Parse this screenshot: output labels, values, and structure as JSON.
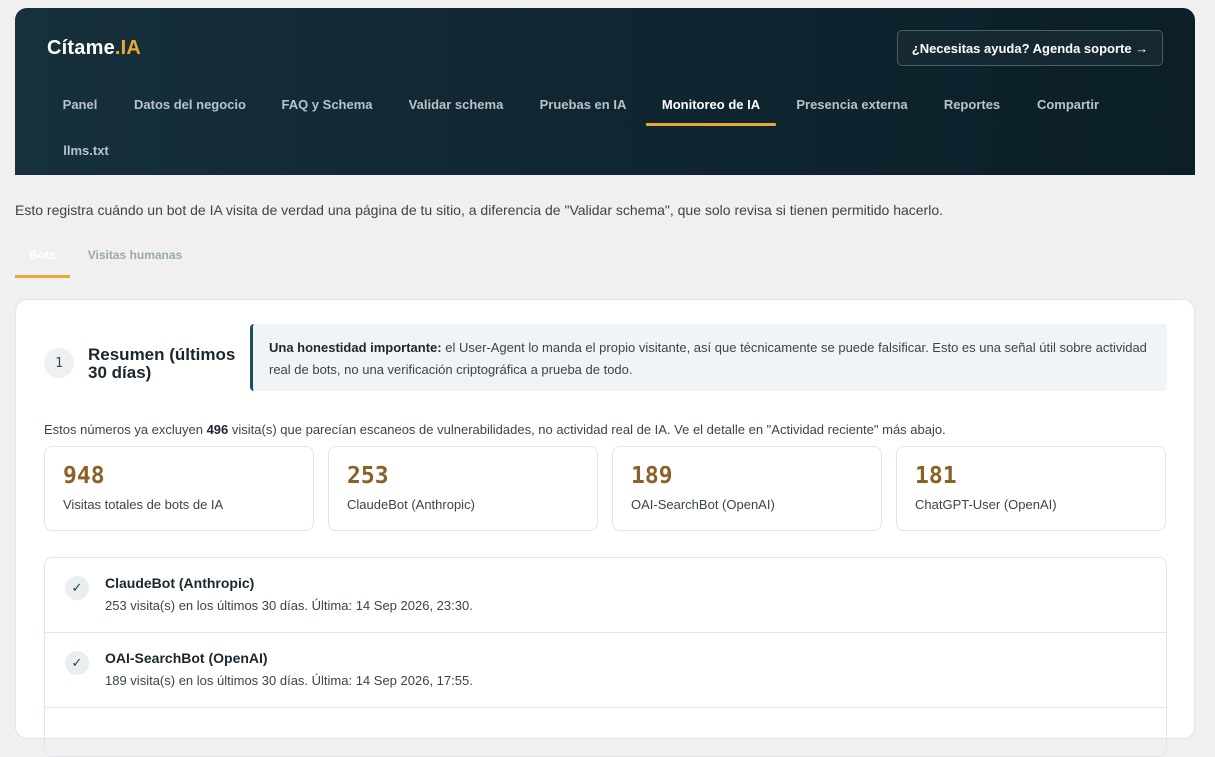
{
  "header": {
    "logo_main": "Cítame",
    "logo_accent": ".IA",
    "help_button": "¿Necesitas ayuda? Agenda soporte →"
  },
  "nav": [
    {
      "label": "Panel",
      "active": false
    },
    {
      "label": "Datos del negocio",
      "active": false
    },
    {
      "label": "FAQ y Schema",
      "active": false
    },
    {
      "label": "Validar schema",
      "active": false
    },
    {
      "label": "Pruebas en IA",
      "active": false
    },
    {
      "label": "Monitoreo de IA",
      "active": true
    },
    {
      "label": "Presencia externa",
      "active": false
    },
    {
      "label": "Reportes",
      "active": false
    },
    {
      "label": "Compartir",
      "active": false
    },
    {
      "label": "llms.txt",
      "active": false
    }
  ],
  "intro": "Esto registra cuándo un bot de IA visita de verdad una página de tu sitio, a diferencia de \"Validar schema\", que solo revisa si tienen permitido hacerlo.",
  "subtabs": [
    {
      "label": "Bots",
      "active": true
    },
    {
      "label": "Visitas humanas",
      "active": false
    }
  ],
  "summary": {
    "step": "1",
    "title": "Resumen (últimos 30 días)",
    "notice_strong": "Una honestidad importante:",
    "notice_text": " el User-Agent lo manda el propio visitante, así que técnicamente se puede falsificar. Esto es una señal útil sobre actividad real de bots, no una verificación criptográfica a prueba de todo.",
    "exclusion_before": "Estos números ya excluyen ",
    "exclusion_count": "496",
    "exclusion_after": " visita(s) que parecían escaneos de vulnerabilidades, no actividad real de IA. Ve el detalle en \"Actividad reciente\" más abajo."
  },
  "stats": [
    {
      "value": "948",
      "label": "Visitas totales de bots de IA"
    },
    {
      "value": "253",
      "label": "ClaudeBot (Anthropic)"
    },
    {
      "value": "189",
      "label": "OAI-SearchBot (OpenAI)"
    },
    {
      "value": "181",
      "label": "ChatGPT-User (OpenAI)"
    }
  ],
  "bots": [
    {
      "name": "ClaudeBot (Anthropic)",
      "meta": "253 visita(s) en los últimos 30 días. Última: 14 Sep 2026, 23:30.",
      "icon": "check-icon"
    },
    {
      "name": "OAI-SearchBot (OpenAI)",
      "meta": "189 visita(s) en los últimos 30 días. Última: 14 Sep 2026, 17:55.",
      "icon": "check-icon"
    }
  ],
  "colors": {
    "accent": "#e8a83a",
    "header_bg": "#0f2530",
    "stat_value": "#8a6226"
  }
}
